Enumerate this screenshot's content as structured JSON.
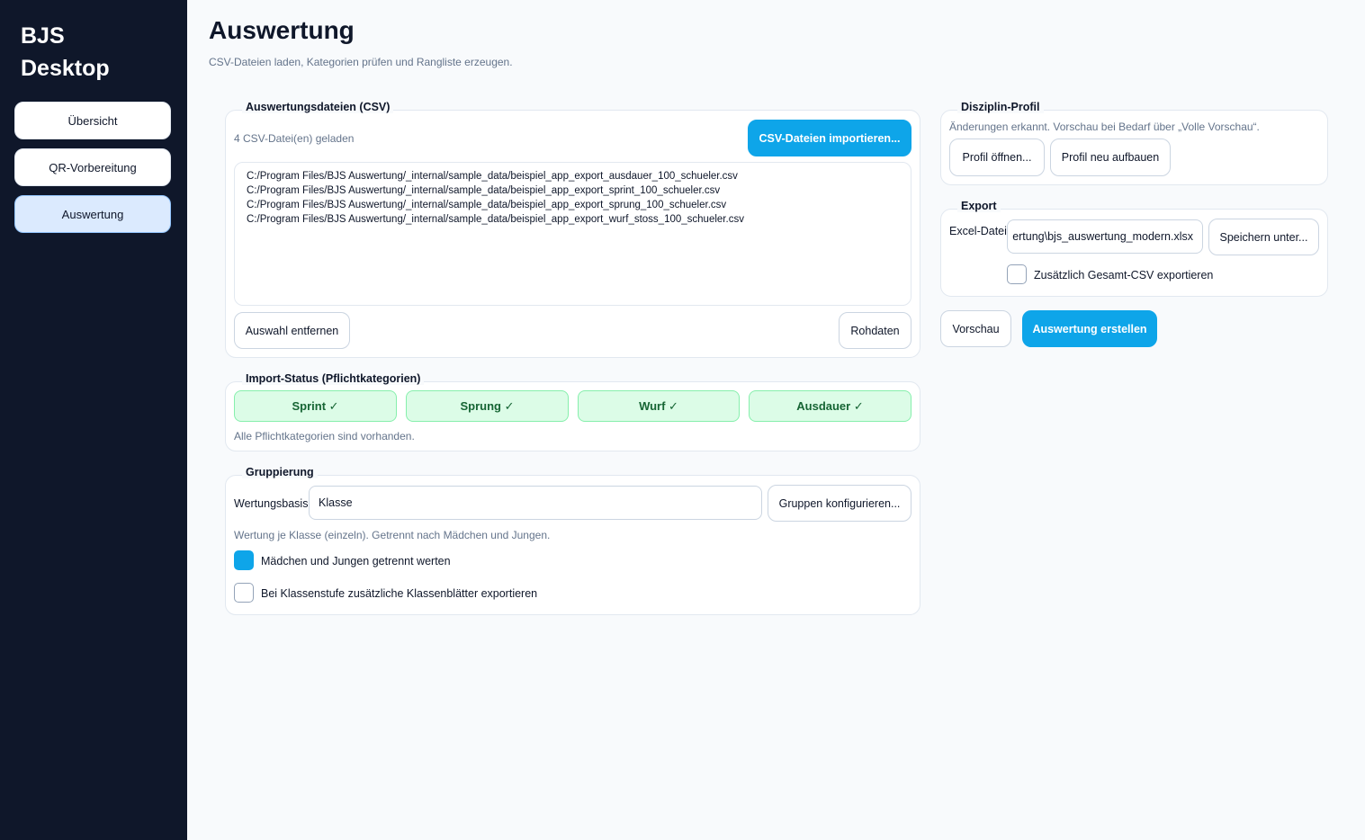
{
  "app": {
    "title_line1": "BJS",
    "title_line2": "Desktop"
  },
  "sidebar": {
    "items": [
      {
        "label": "Übersicht"
      },
      {
        "label": "QR-Vorbereitung"
      },
      {
        "label": "Auswertung"
      }
    ]
  },
  "page": {
    "title": "Auswertung",
    "subtitle": "CSV-Dateien laden, Kategorien prüfen und Rangliste erzeugen."
  },
  "files_card": {
    "title": "Auswertungsdateien (CSV)",
    "count_text": "4 CSV-Datei(en) geladen",
    "import_button": "CSV-Dateien importieren...",
    "files": [
      "C:/Program Files/BJS Auswertung/_internal/sample_data/beispiel_app_export_ausdauer_100_schueler.csv",
      "C:/Program Files/BJS Auswertung/_internal/sample_data/beispiel_app_export_sprint_100_schueler.csv",
      "C:/Program Files/BJS Auswertung/_internal/sample_data/beispiel_app_export_sprung_100_schueler.csv",
      "C:/Program Files/BJS Auswertung/_internal/sample_data/beispiel_app_export_wurf_stoss_100_schueler.csv"
    ],
    "remove_button": "Auswahl entfernen",
    "raw_button": "Rohdaten"
  },
  "import_status": {
    "title": "Import-Status (Pflichtkategorien)",
    "chips": [
      {
        "label": "Sprint ✓"
      },
      {
        "label": "Sprung ✓"
      },
      {
        "label": "Wurf ✓"
      },
      {
        "label": "Ausdauer ✓"
      }
    ],
    "note": "Alle Pflichtkategorien sind vorhanden."
  },
  "grouping": {
    "title": "Gruppierung",
    "basis_label": "Wertungsbasis",
    "basis_value": "Klasse",
    "configure_button": "Gruppen konfigurieren...",
    "description": "Wertung je Klasse (einzeln). Getrennt nach Mädchen und Jungen.",
    "separate_gender_label": "Mädchen und Jungen getrennt werten",
    "separate_gender_checked": true,
    "class_sheets_label": "Bei Klassenstufe zusätzliche Klassenblätter exportieren",
    "class_sheets_checked": false
  },
  "profile": {
    "title": "Disziplin-Profil",
    "note": "Änderungen erkannt. Vorschau bei Bedarf über „Volle Vorschau“.",
    "open_button": "Profil öffnen...",
    "rebuild_button": "Profil neu aufbauen"
  },
  "export": {
    "title": "Export",
    "file_label": "Excel-Datei",
    "file_value": "ertung\\bjs_auswertung_modern.xlsx",
    "save_button": "Speichern unter...",
    "csv_label": "Zusätzlich Gesamt-CSV exportieren",
    "csv_checked": false
  },
  "actions": {
    "preview_button": "Vorschau",
    "create_button": "Auswertung erstellen"
  },
  "colors": {
    "sidebar_bg": "#0f172a",
    "accent": "#0ea5e9",
    "success_bg": "#dcfce7",
    "success_text": "#166534"
  }
}
